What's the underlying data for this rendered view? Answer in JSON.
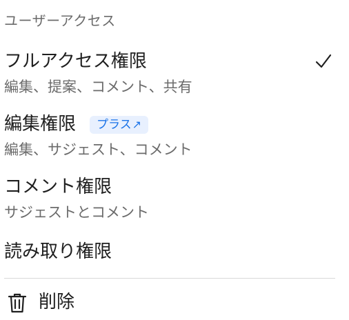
{
  "menu": {
    "header": "ユーザーアクセス",
    "options": [
      {
        "title": "フルアクセス権限",
        "description": "編集、提案、コメント、共有",
        "selected": true
      },
      {
        "title": "編集権限",
        "description": "編集、サジェスト、コメント",
        "badge": "プラス",
        "badge_icon": "↗",
        "selected": false
      },
      {
        "title": "コメント権限",
        "description": "サジェストとコメント",
        "selected": false
      },
      {
        "title": "読み取り権限",
        "selected": false
      }
    ],
    "delete_label": "削除"
  },
  "icons": {
    "selected": "checkmark-icon",
    "delete": "trash-icon",
    "badge": "external-arrow-icon"
  },
  "colors": {
    "badge_background": "#e8f0fe",
    "badge_text": "#1a73e8",
    "secondary_text": "#6b6b6b"
  }
}
